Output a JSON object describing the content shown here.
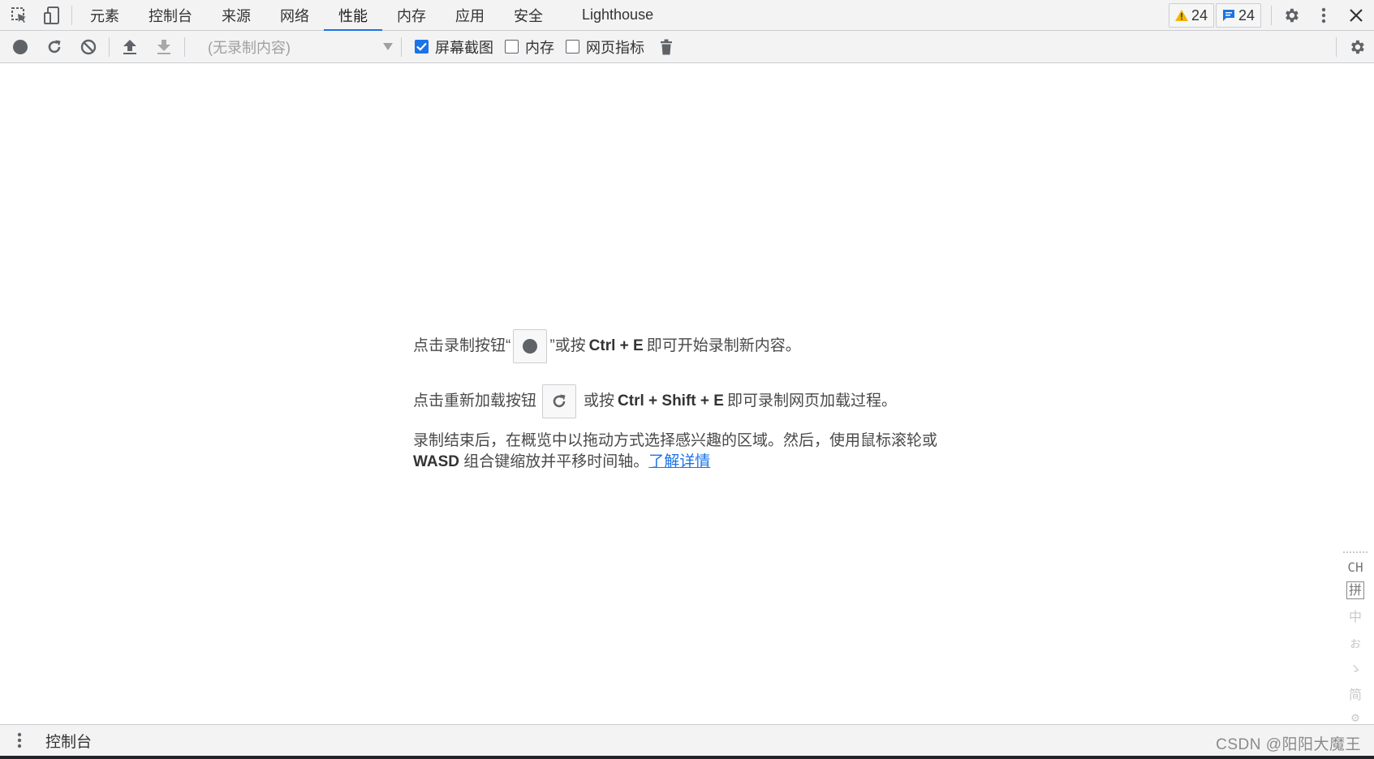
{
  "tabbar": {
    "tabs": [
      "元素",
      "控制台",
      "来源",
      "网络",
      "性能",
      "内存",
      "应用",
      "安全",
      "Lighthouse"
    ],
    "active_tab": "性能",
    "warnings_count": "24",
    "messages_count": "24"
  },
  "toolbar": {
    "select_placeholder": "(无录制内容)",
    "screenshots_label": "屏幕截图",
    "screenshots_checked": true,
    "memory_label": "内存",
    "memory_checked": false,
    "web_vitals_label": "网页指标",
    "web_vitals_checked": false
  },
  "landing": {
    "record_prefix": "点击录制按钮“",
    "record_mid": "”或按",
    "record_shortcut": "Ctrl + E",
    "record_suffix": "即可开始录制新内容。",
    "reload_prefix": "点击重新加载按钮",
    "reload_mid": "或按",
    "reload_shortcut": "Ctrl + Shift + E",
    "reload_suffix": "即可录制网页加载过程。",
    "help_text_1": "录制结束后，在概览中以拖动方式选择感兴趣的区域。然后，使用鼠标滚轮或",
    "help_keys": "WASD",
    "help_text_2": "组合键缩放并平移时间轴。",
    "learn_more": "了解详情"
  },
  "drawer": {
    "tab_label": "控制台"
  },
  "ime": {
    "lang": "CH",
    "mode": "拼",
    "chars": [
      "中",
      "ぉ",
      "ゝ",
      "简",
      "⚙"
    ]
  },
  "watermark": "CSDN @阳阳大魔王",
  "colors": {
    "accent": "#1a73e8",
    "warning": "#f2b600",
    "toolbar_bg": "#f3f3f3",
    "icon": "#5f6368"
  },
  "icons": [
    "inspect-element-icon",
    "device-toggle-icon",
    "record-icon",
    "reload-icon",
    "clear-icon",
    "upload-icon",
    "download-icon",
    "trash-icon",
    "settings-icon",
    "more-vertical-icon",
    "close-icon",
    "warning-icon",
    "message-icon"
  ]
}
